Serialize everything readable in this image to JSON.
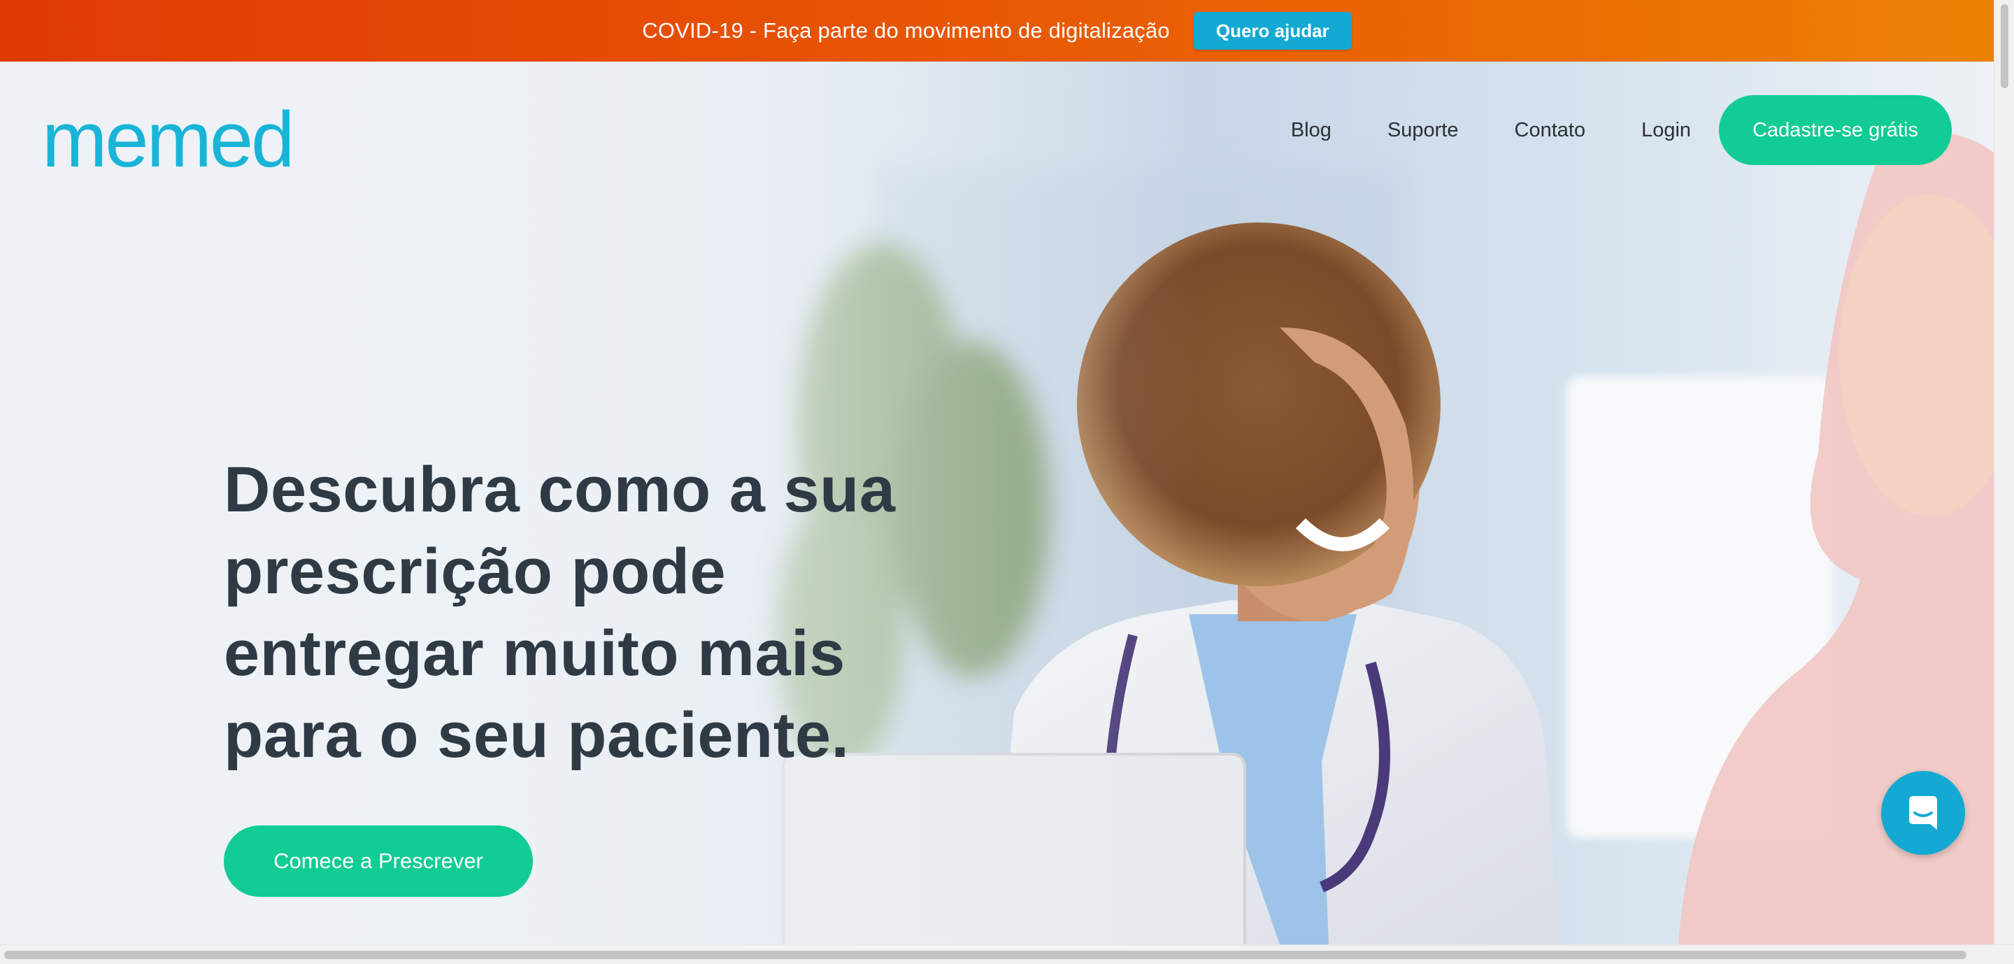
{
  "banner": {
    "text": "COVID-19 - Faça parte do movimento de digitalização",
    "button_label": "Quero ajudar",
    "colors": {
      "gradient_start": "#e03a05",
      "gradient_end": "#ec8204",
      "button": "#14a9d2"
    }
  },
  "header": {
    "logo_text": "memed",
    "nav": [
      {
        "label": "Blog"
      },
      {
        "label": "Suporte"
      },
      {
        "label": "Contato"
      },
      {
        "label": "Login"
      }
    ],
    "cta_label": "Cadastre-se grátis"
  },
  "hero": {
    "headline_lines": [
      "Descubra como a sua",
      "prescrição pode",
      "entregar muito mais",
      "para o seu paciente."
    ],
    "cta_label": "Comece a Prescrever",
    "image_icon": "doctor-smiling-photo"
  },
  "chat": {
    "icon": "chat-bubble-icon"
  },
  "colors": {
    "brand": "#19b4d8",
    "accent_green": "#11cc94",
    "headline": "#2f3a45"
  }
}
